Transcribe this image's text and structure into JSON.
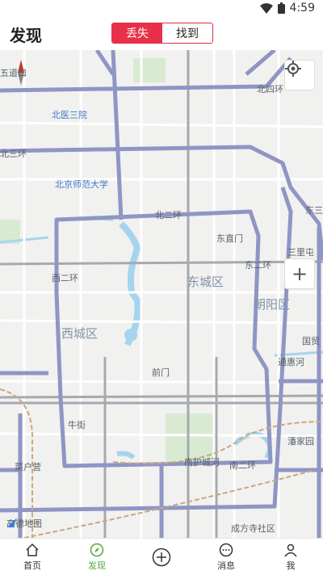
{
  "status": {
    "time": "4:59"
  },
  "header": {
    "title": "发现",
    "tabs": [
      "丢失",
      "找到"
    ]
  },
  "map": {
    "labels": {
      "beiyi": "北医三院",
      "bnu": "北京师范大学",
      "bei3huan": "北三环",
      "beisihuan": "北四环",
      "beierhuan": "北二环",
      "dongzhimen": "东直门",
      "sanlitun": "三里屯",
      "dongcheng": "东城区",
      "chaoyang": "朝阳区",
      "xicheng": "西城区",
      "xierhuan": "西二环",
      "dongerhuan": "东二环",
      "dongsanhuan": "东三环",
      "guomao": "国贸",
      "tonghuihe": "通惠河",
      "qianmen": "前门",
      "niujie": "牛街",
      "panjiayuan": "潘家园",
      "nanhucheng": "南护城河",
      "nanerhuan": "南二环",
      "caihukou": "菜户营",
      "fengtai": "成方寺社区",
      "wudaokou": "五道口"
    },
    "logo": "高德地图",
    "controls": {
      "locate": "locate-icon",
      "zoom": "+"
    }
  },
  "tabbar": [
    "首页",
    "发现",
    "",
    "消息",
    "我"
  ]
}
